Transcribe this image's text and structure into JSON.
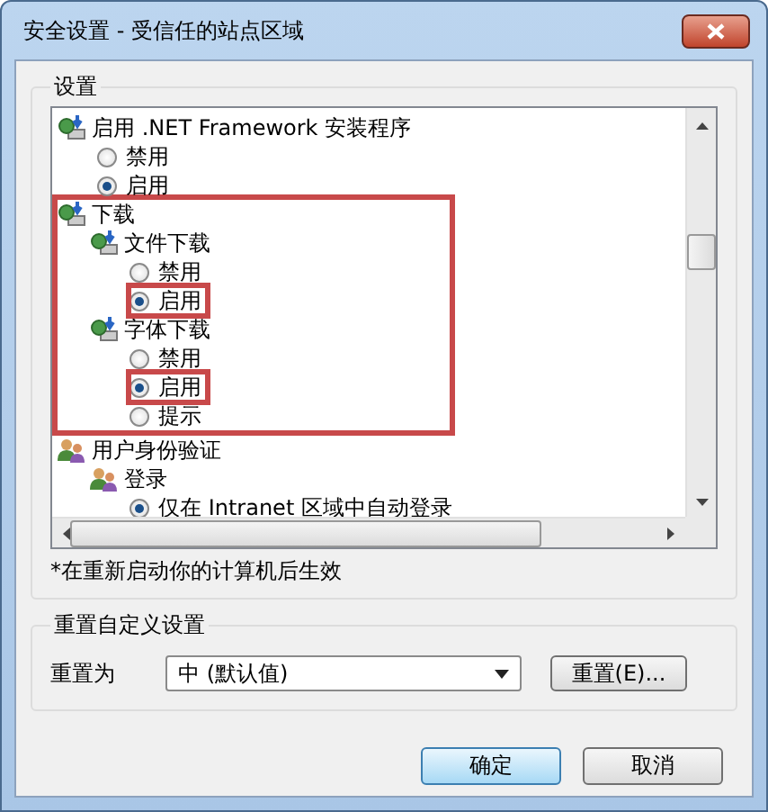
{
  "window": {
    "title": "安全设置 - 受信任的站点区域"
  },
  "settings": {
    "label": "设置",
    "tree": [
      {
        "kind": "setting",
        "label": "启用 .NET Framework 安装程序",
        "highlighted": false,
        "children": [
          {
            "kind": "radio",
            "label": "禁用",
            "selected": false,
            "highlighted": false
          },
          {
            "kind": "radio",
            "label": "启用",
            "selected": true,
            "highlighted": false
          }
        ]
      },
      {
        "kind": "setting",
        "label": "下载",
        "highlighted": true,
        "children": [
          {
            "kind": "setting",
            "label": "文件下载",
            "highlighted": false,
            "children": [
              {
                "kind": "radio",
                "label": "禁用",
                "selected": false,
                "highlighted": false
              },
              {
                "kind": "radio",
                "label": "启用",
                "selected": true,
                "highlighted": true
              }
            ]
          },
          {
            "kind": "setting",
            "label": "字体下载",
            "highlighted": false,
            "children": [
              {
                "kind": "radio",
                "label": "禁用",
                "selected": false,
                "highlighted": false
              },
              {
                "kind": "radio",
                "label": "启用",
                "selected": true,
                "highlighted": true
              },
              {
                "kind": "radio",
                "label": "提示",
                "selected": false,
                "highlighted": false
              }
            ]
          }
        ]
      },
      {
        "kind": "user-setting",
        "label": "用户身份验证",
        "highlighted": false,
        "children": [
          {
            "kind": "user-setting",
            "label": "登录",
            "highlighted": false,
            "children": [
              {
                "kind": "radio",
                "label": "仅在 Intranet 区域中自动登录",
                "selected": true,
                "highlighted": false
              }
            ]
          }
        ]
      }
    ],
    "note": "*在重新启动你的计算机后生效"
  },
  "reset": {
    "label": "重置自定义设置",
    "field_label": "重置为",
    "dropdown_value": "中 (默认值)",
    "button": "重置(E)..."
  },
  "buttons": [
    {
      "label": "确定",
      "kind": "default"
    },
    {
      "label": "取消",
      "kind": "normal"
    }
  ]
}
